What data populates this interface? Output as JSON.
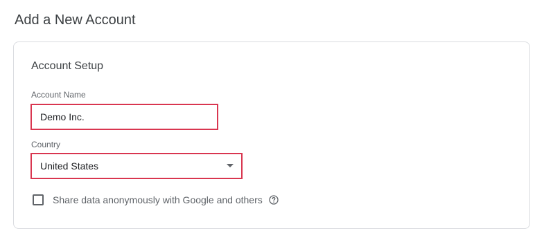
{
  "page": {
    "title": "Add a New Account"
  },
  "account_setup": {
    "title": "Account Setup",
    "account_name": {
      "label": "Account Name",
      "value": "Demo Inc."
    },
    "country": {
      "label": "Country",
      "selected": "United States"
    },
    "share_data": {
      "label": "Share data anonymously with Google and others",
      "checked": false
    }
  },
  "colors": {
    "highlight_border": "#d93650",
    "card_border": "#dadce0",
    "secondary_text": "#5f6368"
  },
  "icons": {
    "dropdown": "caret-down-icon",
    "help": "help-circle-icon"
  }
}
